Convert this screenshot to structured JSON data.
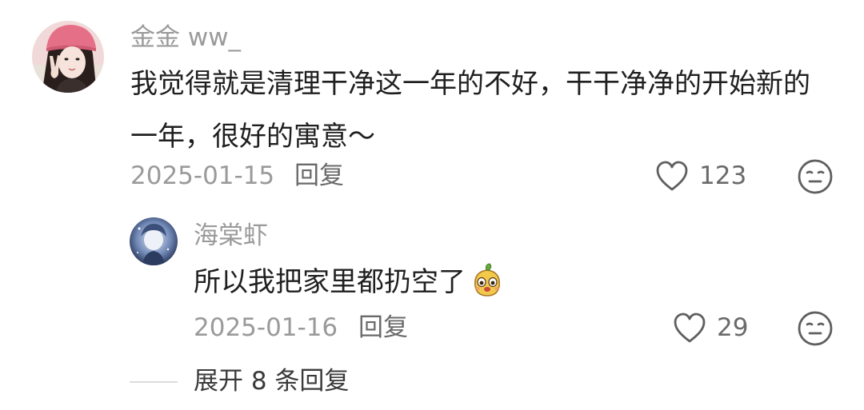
{
  "comment": {
    "username": "金金 ww_",
    "text_line1": "我觉得就是清理干净这一年的不好，干干净净的开始新的",
    "text_line2": "一年，很好的寓意～",
    "date": "2025-01-15",
    "reply_label": "回复",
    "like_count": "123",
    "avatar_icon": "user-avatar-pink-hat",
    "like_icon": "heart-outline-icon",
    "reaction_icon": "neutral-face-icon"
  },
  "reply": {
    "username": "海棠虾",
    "text": "所以我把家里都扔空了",
    "sticker_icon": "yellow-cartoon-sticker",
    "date": "2025-01-16",
    "reply_label": "回复",
    "like_count": "29",
    "avatar_icon": "user-avatar-blue",
    "like_icon": "heart-outline-icon",
    "reaction_icon": "neutral-face-icon"
  },
  "expand": {
    "label": "展开 8 条回复"
  },
  "colors": {
    "text_primary": "#1f1f1f",
    "text_secondary": "#9a9a9a",
    "text_action": "#6a6a6a"
  }
}
